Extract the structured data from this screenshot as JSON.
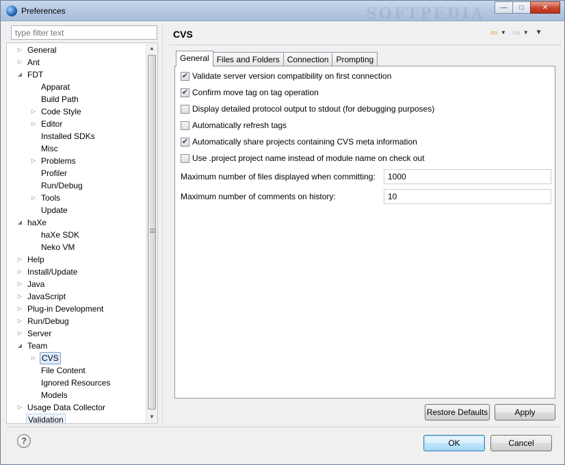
{
  "window": {
    "title": "Preferences",
    "minimize_glyph": "—",
    "maximize_glyph": "□",
    "close_glyph": "✕",
    "watermark": "SOFTPEDIA"
  },
  "filter": {
    "placeholder": "type filter text"
  },
  "tree": [
    {
      "label": "General",
      "depth": 0,
      "twisty": "closed"
    },
    {
      "label": "Ant",
      "depth": 0,
      "twisty": "closed"
    },
    {
      "label": "FDT",
      "depth": 0,
      "twisty": "open"
    },
    {
      "label": "Apparat",
      "depth": 1,
      "twisty": "none"
    },
    {
      "label": "Build Path",
      "depth": 1,
      "twisty": "none"
    },
    {
      "label": "Code Style",
      "depth": 1,
      "twisty": "closed"
    },
    {
      "label": "Editor",
      "depth": 1,
      "twisty": "closed"
    },
    {
      "label": "Installed SDKs",
      "depth": 1,
      "twisty": "none"
    },
    {
      "label": "Misc",
      "depth": 1,
      "twisty": "none"
    },
    {
      "label": "Problems",
      "depth": 1,
      "twisty": "closed"
    },
    {
      "label": "Profiler",
      "depth": 1,
      "twisty": "none"
    },
    {
      "label": "Run/Debug",
      "depth": 1,
      "twisty": "none"
    },
    {
      "label": "Tools",
      "depth": 1,
      "twisty": "closed"
    },
    {
      "label": "Update",
      "depth": 1,
      "twisty": "none"
    },
    {
      "label": "haXe",
      "depth": 0,
      "twisty": "open"
    },
    {
      "label": "haXe SDK",
      "depth": 1,
      "twisty": "none"
    },
    {
      "label": "Neko VM",
      "depth": 1,
      "twisty": "none"
    },
    {
      "label": "Help",
      "depth": 0,
      "twisty": "closed"
    },
    {
      "label": "Install/Update",
      "depth": 0,
      "twisty": "closed"
    },
    {
      "label": "Java",
      "depth": 0,
      "twisty": "closed"
    },
    {
      "label": "JavaScript",
      "depth": 0,
      "twisty": "closed"
    },
    {
      "label": "Plug-in Development",
      "depth": 0,
      "twisty": "closed"
    },
    {
      "label": "Run/Debug",
      "depth": 0,
      "twisty": "closed"
    },
    {
      "label": "Server",
      "depth": 0,
      "twisty": "closed"
    },
    {
      "label": "Team",
      "depth": 0,
      "twisty": "open"
    },
    {
      "label": "CVS",
      "depth": 1,
      "twisty": "closed",
      "state": "selected"
    },
    {
      "label": "File Content",
      "depth": 1,
      "twisty": "none"
    },
    {
      "label": "Ignored Resources",
      "depth": 1,
      "twisty": "none"
    },
    {
      "label": "Models",
      "depth": 1,
      "twisty": "none"
    },
    {
      "label": "Usage Data Collector",
      "depth": 0,
      "twisty": "closed"
    },
    {
      "label": "Validation",
      "depth": 0,
      "twisty": "none",
      "state": "hl"
    }
  ],
  "page": {
    "title": "CVS"
  },
  "tabs": [
    {
      "label": "General",
      "active": true
    },
    {
      "label": "Files and Folders",
      "active": false
    },
    {
      "label": "Connection",
      "active": false
    },
    {
      "label": "Prompting",
      "active": false
    }
  ],
  "options": [
    {
      "label": "Validate server version compatibility on first connection",
      "checked": true
    },
    {
      "label": "Confirm move tag on tag operation",
      "checked": true
    },
    {
      "label": "Display detailed protocol output to stdout (for debugging purposes)",
      "checked": false
    },
    {
      "label": "Automatically refresh tags",
      "checked": false
    },
    {
      "label": "Automatically share projects containing CVS meta information",
      "checked": true
    },
    {
      "label": "Use .project project name instead of module name on check out",
      "checked": false
    }
  ],
  "fields": [
    {
      "label": "Maximum number of files displayed when committing:",
      "value": "1000"
    },
    {
      "label": "Maximum number of comments on history:",
      "value": "10"
    }
  ],
  "buttons": {
    "restore_defaults": "Restore Defaults",
    "apply": "Apply",
    "ok": "OK",
    "cancel": "Cancel",
    "help_glyph": "?"
  },
  "colors": {
    "titlebar": "#b5c9e2",
    "selection": "#dcecfc",
    "close": "#c9442c"
  }
}
